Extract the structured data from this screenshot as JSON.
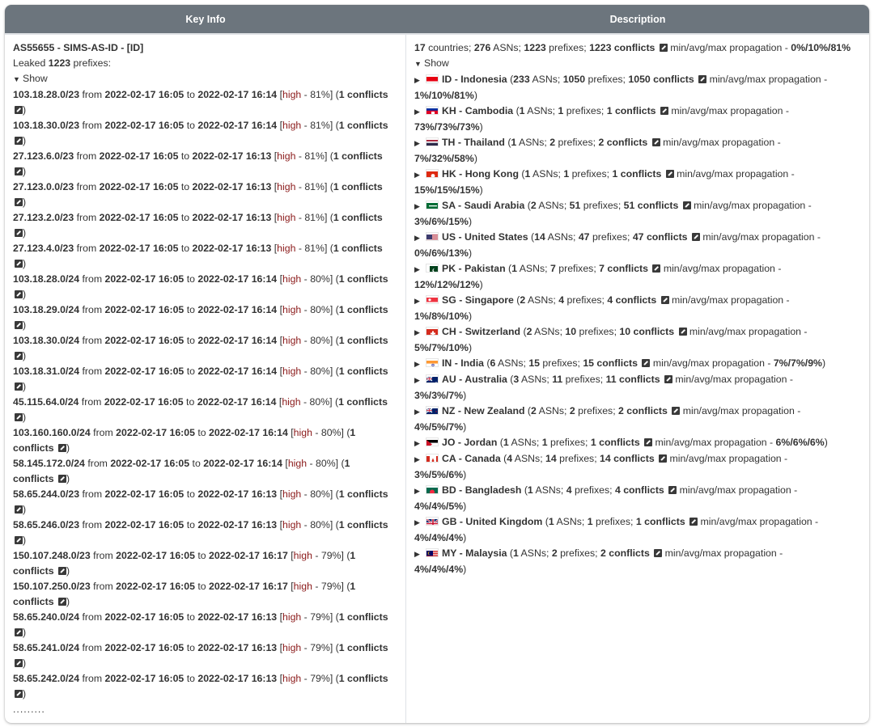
{
  "table": {
    "headers": [
      "Key Info",
      "Description"
    ]
  },
  "key_info": {
    "asn": "AS55655 - SIMS-AS-ID - [ID]",
    "leaked_prefix": "Leaked ",
    "leaked_count": "1223",
    "leaked_suffix": " prefixes:",
    "show_label": "Show",
    "from_word": " from ",
    "to_word": " to ",
    "conflicts_word": "conflicts",
    "ellipsis": ".........",
    "entries": [
      {
        "prefix": "103.18.28.0/23",
        "from": "2022-02-17 16:05",
        "to": "2022-02-17 16:14",
        "severity": "high",
        "pct": "81%",
        "conflicts": "1"
      },
      {
        "prefix": "103.18.30.0/23",
        "from": "2022-02-17 16:05",
        "to": "2022-02-17 16:14",
        "severity": "high",
        "pct": "81%",
        "conflicts": "1"
      },
      {
        "prefix": "27.123.6.0/23",
        "from": "2022-02-17 16:05",
        "to": "2022-02-17 16:13",
        "severity": "high",
        "pct": "81%",
        "conflicts": "1"
      },
      {
        "prefix": "27.123.0.0/23",
        "from": "2022-02-17 16:05",
        "to": "2022-02-17 16:13",
        "severity": "high",
        "pct": "81%",
        "conflicts": "1"
      },
      {
        "prefix": "27.123.2.0/23",
        "from": "2022-02-17 16:05",
        "to": "2022-02-17 16:13",
        "severity": "high",
        "pct": "81%",
        "conflicts": "1"
      },
      {
        "prefix": "27.123.4.0/23",
        "from": "2022-02-17 16:05",
        "to": "2022-02-17 16:13",
        "severity": "high",
        "pct": "81%",
        "conflicts": "1"
      },
      {
        "prefix": "103.18.28.0/24",
        "from": "2022-02-17 16:05",
        "to": "2022-02-17 16:14",
        "severity": "high",
        "pct": "80%",
        "conflicts": "1"
      },
      {
        "prefix": "103.18.29.0/24",
        "from": "2022-02-17 16:05",
        "to": "2022-02-17 16:14",
        "severity": "high",
        "pct": "80%",
        "conflicts": "1"
      },
      {
        "prefix": "103.18.30.0/24",
        "from": "2022-02-17 16:05",
        "to": "2022-02-17 16:14",
        "severity": "high",
        "pct": "80%",
        "conflicts": "1"
      },
      {
        "prefix": "103.18.31.0/24",
        "from": "2022-02-17 16:05",
        "to": "2022-02-17 16:14",
        "severity": "high",
        "pct": "80%",
        "conflicts": "1"
      },
      {
        "prefix": "45.115.64.0/24",
        "from": "2022-02-17 16:05",
        "to": "2022-02-17 16:14",
        "severity": "high",
        "pct": "80%",
        "conflicts": "1"
      },
      {
        "prefix": "103.160.160.0/24",
        "from": "2022-02-17 16:05",
        "to": "2022-02-17 16:14",
        "severity": "high",
        "pct": "80%",
        "conflicts": "1"
      },
      {
        "prefix": "58.145.172.0/24",
        "from": "2022-02-17 16:05",
        "to": "2022-02-17 16:14",
        "severity": "high",
        "pct": "80%",
        "conflicts": "1"
      },
      {
        "prefix": "58.65.244.0/23",
        "from": "2022-02-17 16:05",
        "to": "2022-02-17 16:13",
        "severity": "high",
        "pct": "80%",
        "conflicts": "1"
      },
      {
        "prefix": "58.65.246.0/23",
        "from": "2022-02-17 16:05",
        "to": "2022-02-17 16:13",
        "severity": "high",
        "pct": "80%",
        "conflicts": "1"
      },
      {
        "prefix": "150.107.248.0/23",
        "from": "2022-02-17 16:05",
        "to": "2022-02-17 16:17",
        "severity": "high",
        "pct": "79%",
        "conflicts": "1"
      },
      {
        "prefix": "150.107.250.0/23",
        "from": "2022-02-17 16:05",
        "to": "2022-02-17 16:17",
        "severity": "high",
        "pct": "79%",
        "conflicts": "1"
      },
      {
        "prefix": "58.65.240.0/24",
        "from": "2022-02-17 16:05",
        "to": "2022-02-17 16:13",
        "severity": "high",
        "pct": "79%",
        "conflicts": "1"
      },
      {
        "prefix": "58.65.241.0/24",
        "from": "2022-02-17 16:05",
        "to": "2022-02-17 16:13",
        "severity": "high",
        "pct": "79%",
        "conflicts": "1"
      },
      {
        "prefix": "58.65.242.0/24",
        "from": "2022-02-17 16:05",
        "to": "2022-02-17 16:13",
        "severity": "high",
        "pct": "79%",
        "conflicts": "1"
      }
    ]
  },
  "description": {
    "summary": {
      "countries": "17",
      "countries_label": " countries; ",
      "asns": "276",
      "asns_label": " ASNs; ",
      "prefixes": "1223",
      "prefixes_label": " prefixes; ",
      "conflicts": "1223 conflicts",
      "propagation_label": " min/avg/max propagation - ",
      "propagation": "0%/10%/81%"
    },
    "show_label": "Show",
    "countries": [
      {
        "code": "ID",
        "name": "Indonesia",
        "asns": "233",
        "prefixes": "1050",
        "conflicts": "1050 conflicts",
        "propagation": "1%/10%/81%",
        "flag": "id"
      },
      {
        "code": "KH",
        "name": "Cambodia",
        "asns": "1",
        "prefixes": "1",
        "conflicts": "1 conflicts",
        "propagation": "73%/73%/73%",
        "flag": "kh"
      },
      {
        "code": "TH",
        "name": "Thailand",
        "asns": "1",
        "prefixes": "2",
        "conflicts": "2 conflicts",
        "propagation": "7%/32%/58%",
        "flag": "th"
      },
      {
        "code": "HK",
        "name": "Hong Kong",
        "asns": "1",
        "prefixes": "1",
        "conflicts": "1 conflicts",
        "propagation": "15%/15%/15%",
        "flag": "hk"
      },
      {
        "code": "SA",
        "name": "Saudi Arabia",
        "asns": "2",
        "prefixes": "51",
        "conflicts": "51 conflicts",
        "propagation": "3%/6%/15%",
        "flag": "sa"
      },
      {
        "code": "US",
        "name": "United States",
        "asns": "14",
        "prefixes": "47",
        "conflicts": "47 conflicts",
        "propagation": "0%/6%/13%",
        "flag": "us"
      },
      {
        "code": "PK",
        "name": "Pakistan",
        "asns": "1",
        "prefixes": "7",
        "conflicts": "7 conflicts",
        "propagation": "12%/12%/12%",
        "flag": "pk"
      },
      {
        "code": "SG",
        "name": "Singapore",
        "asns": "2",
        "prefixes": "4",
        "conflicts": "4 conflicts",
        "propagation": "1%/8%/10%",
        "flag": "sg"
      },
      {
        "code": "CH",
        "name": "Switzerland",
        "asns": "2",
        "prefixes": "10",
        "conflicts": "10 conflicts",
        "propagation": "5%/7%/10%",
        "flag": "ch"
      },
      {
        "code": "IN",
        "name": "India",
        "asns": "6",
        "prefixes": "15",
        "conflicts": "15 conflicts",
        "propagation": "7%/7%/9%",
        "flag": "in"
      },
      {
        "code": "AU",
        "name": "Australia",
        "asns": "3",
        "prefixes": "11",
        "conflicts": "11 conflicts",
        "propagation": "3%/3%/7%",
        "flag": "au"
      },
      {
        "code": "NZ",
        "name": "New Zealand",
        "asns": "2",
        "prefixes": "2",
        "conflicts": "2 conflicts",
        "propagation": "4%/5%/7%",
        "flag": "nz"
      },
      {
        "code": "JO",
        "name": "Jordan",
        "asns": "1",
        "prefixes": "1",
        "conflicts": "1 conflicts",
        "propagation": "6%/6%/6%",
        "flag": "jo"
      },
      {
        "code": "CA",
        "name": "Canada",
        "asns": "4",
        "prefixes": "14",
        "conflicts": "14 conflicts",
        "propagation": "3%/5%/6%",
        "flag": "ca"
      },
      {
        "code": "BD",
        "name": "Bangladesh",
        "asns": "1",
        "prefixes": "4",
        "conflicts": "4 conflicts",
        "propagation": "4%/4%/5%",
        "flag": "bd"
      },
      {
        "code": "GB",
        "name": "United Kingdom",
        "asns": "1",
        "prefixes": "1",
        "conflicts": "1 conflicts",
        "propagation": "4%/4%/4%",
        "flag": "gb"
      },
      {
        "code": "MY",
        "name": "Malaysia",
        "asns": "1",
        "prefixes": "2",
        "conflicts": "2 conflicts",
        "propagation": "4%/4%/4%",
        "flag": "my"
      }
    ]
  },
  "colors": {
    "header_bg": "#6c757d",
    "severity_text": "#8b1a1a",
    "text": "#333333"
  }
}
